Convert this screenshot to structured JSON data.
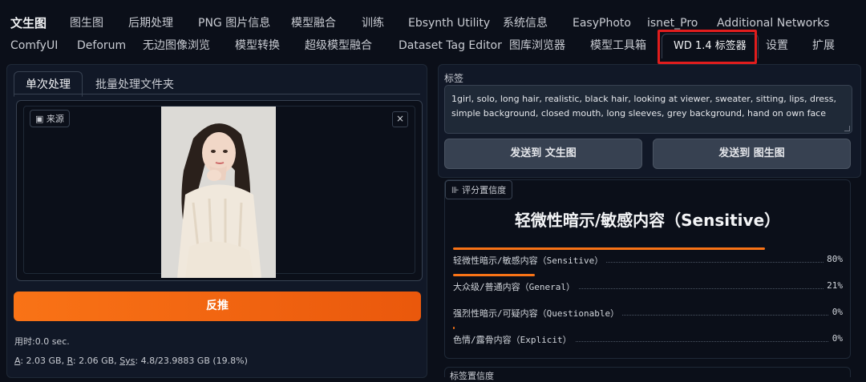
{
  "tabs_row1": [
    {
      "label": "文生图",
      "active": true
    },
    {
      "label": "图生图"
    },
    {
      "label": "后期处理"
    },
    {
      "label": "PNG 图片信息"
    },
    {
      "label": "模型融合"
    },
    {
      "label": "训练"
    },
    {
      "label": "Ebsynth Utility"
    },
    {
      "label": "系统信息"
    },
    {
      "label": "EasyPhoto"
    },
    {
      "label": "isnet_Pro"
    },
    {
      "label": "Additional Networks"
    }
  ],
  "tabs_row2": [
    {
      "label": "ComfyUI"
    },
    {
      "label": "Deforum"
    },
    {
      "label": "无边图像浏览"
    },
    {
      "label": "模型转换"
    },
    {
      "label": "超级模型融合"
    },
    {
      "label": "Dataset Tag Editor"
    },
    {
      "label": "图库浏览器"
    },
    {
      "label": "模型工具箱"
    },
    {
      "label": "WD 1.4 标签器",
      "selected": true
    },
    {
      "label": "设置"
    },
    {
      "label": "扩展"
    }
  ],
  "left": {
    "subtabs": [
      "单次处理",
      "批量处理文件夹"
    ],
    "source_label": "来源",
    "close": "×",
    "interrogate_button": "反推",
    "time": "用时:0.0 sec.",
    "mem_a": "A",
    "mem_a_val": ": 2.03 GB, ",
    "mem_r": "R",
    "mem_r_val": ": 2.06 GB, ",
    "mem_sys": "Sys",
    "mem_sys_val": ": 4.8/23.9883 GB (19.8%)"
  },
  "right": {
    "tags_label": "标签",
    "tags_value": "1girl, solo, long hair, realistic, black hair, looking at viewer, sweater, sitting, lips, dress, simple background, closed mouth, long sleeves, grey background, hand on own face",
    "send_txt2img": "发送到 文生图",
    "send_img2img": "发送到 图生图",
    "rating_label": "评分置信度",
    "rating_title": "轻微性暗示/敏感内容（Sensitive）",
    "ratings": [
      {
        "name": "轻微性暗示/敏感内容（Sensitive）",
        "value": "80%",
        "fraction": 0.8
      },
      {
        "name": "大众级/普通内容（General）",
        "value": "21%",
        "fraction": 0.21
      },
      {
        "name": "强烈性暗示/可疑内容（Questionable）",
        "value": "0%",
        "fraction": 0.0
      },
      {
        "name": "色情/露骨内容（Explicit）",
        "value": "0%",
        "fraction": 0.005
      }
    ],
    "tag_conf_label": "标签置信度"
  },
  "colors": {
    "accent": "#f97316",
    "highlight": "#e11d1d",
    "background": "#0b0f19"
  }
}
